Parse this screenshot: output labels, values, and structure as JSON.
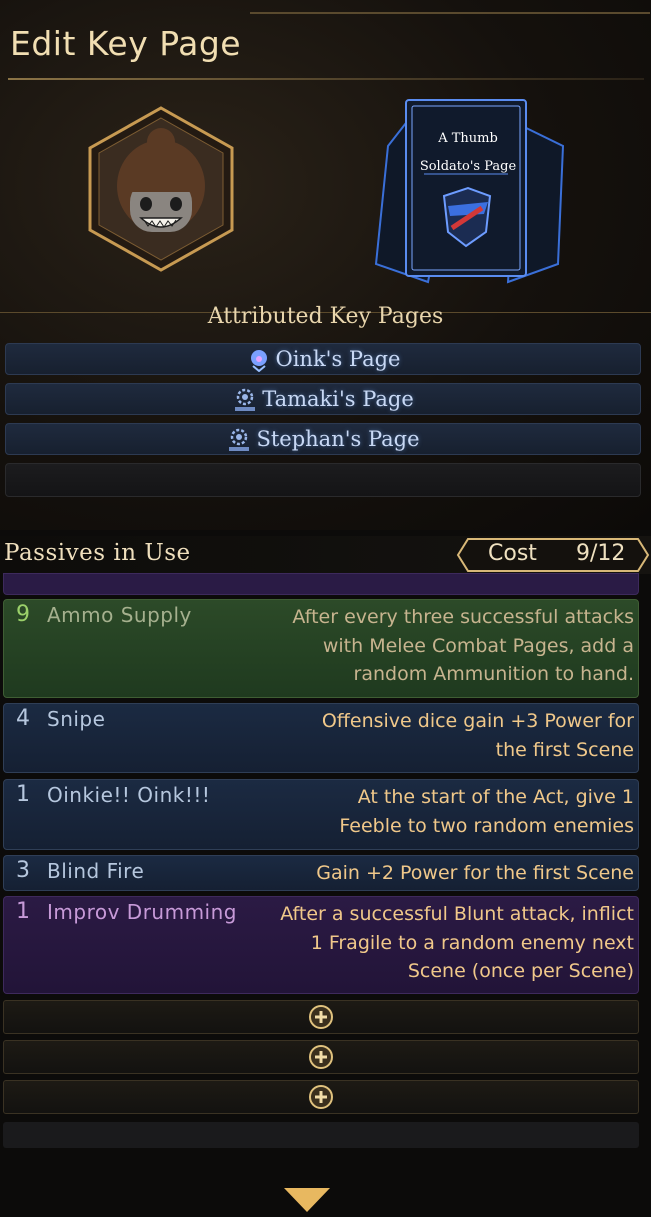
{
  "header": {
    "title": "Edit Key Page"
  },
  "key_page": {
    "title_line1": "A Thumb",
    "title_line2": "Soldato's Page"
  },
  "attributed": {
    "heading": "Attributed Key Pages",
    "items": [
      {
        "label": "Oink's Page",
        "icon": "pig-icon"
      },
      {
        "label": "Tamaki's Page",
        "icon": "gear-emblem-icon"
      },
      {
        "label": "Stephan's Page",
        "icon": "gear-emblem-icon"
      }
    ]
  },
  "passives": {
    "heading": "Passives in Use",
    "cost_label": "Cost",
    "cost_value": "9/12",
    "items": [
      {
        "cost": "9",
        "name": "Ammo Supply",
        "desc": "After every three successful attacks with Melee Combat Pages, add a random Ammunition to hand.",
        "color": "#2c4a28"
      },
      {
        "cost": "4",
        "name": "Snipe",
        "desc": "Offensive dice gain +3 Power for the first Scene",
        "color": "#1b2a42"
      },
      {
        "cost": "1",
        "name": "Oinkie!! Oink!!!",
        "desc": "At the start of the Act, give 1 Feeble to two random enemies",
        "color": "#1b2a42"
      },
      {
        "cost": "3",
        "name": "Blind Fire",
        "desc": "Gain +2 Power for the first Scene",
        "color": "#1b2a42"
      },
      {
        "cost": "1",
        "name": "Improv Drumming",
        "desc": "After a successful Blunt attack, inflict 1 Fragile to a random enemy next Scene (once per Scene)",
        "color": "#2b1a44"
      }
    ]
  },
  "colors": {
    "accent": "#c9a464",
    "text": "#e9d3a6",
    "desc": "#f0c88a"
  }
}
